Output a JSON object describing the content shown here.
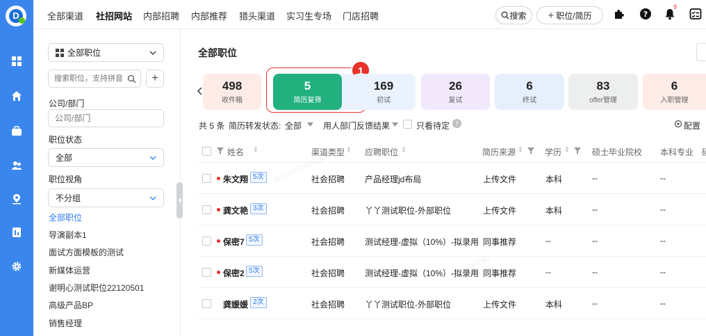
{
  "topnav": {
    "tabs": [
      "全部渠道",
      "社招网站",
      "内部招聘",
      "内部推荐",
      "猎头渠道",
      "实习生专场",
      "门店招聘"
    ],
    "search_label": "搜索",
    "add_label": "职位/简历",
    "notification_count": "9"
  },
  "sidebar": {
    "scope_select": "全部职位",
    "search_placeholder": "搜索职位，支持拼音",
    "company_label": "公司/部门",
    "company_placeholder": "公司/部门",
    "status_label": "职位状态",
    "status_value": "全部",
    "view_label": "职位视角",
    "view_value": "不分组",
    "jobs": [
      "全部职位",
      "导演副本1",
      "面试方面模板的测试",
      "新媒体运营",
      "谢明心测试职位22120501",
      "高级产品BP",
      "销售经理"
    ]
  },
  "main": {
    "title": "全部职位",
    "stages": [
      {
        "num": "498",
        "cap": "收件箱"
      },
      {
        "num": "5",
        "cap": "简历复筛"
      },
      {
        "num": "169",
        "cap": "初试"
      },
      {
        "num": "26",
        "cap": "复试"
      },
      {
        "num": "6",
        "cap": "终试"
      },
      {
        "num": "83",
        "cap": "offer管理"
      },
      {
        "num": "6",
        "cap": "入职管理"
      }
    ],
    "callout_number": "1",
    "filters": {
      "total": "共 5 条",
      "forward_label": "简历转发状态:",
      "forward_value": "全部",
      "feedback_label": "用人部门反馈结果",
      "pending_label": "只看待定",
      "config_label": "配置"
    },
    "columns": [
      "姓名",
      "渠道类型",
      "应聘职位",
      "简历来源",
      "学历",
      "硕士毕业院校",
      "本科专业",
      "硕"
    ],
    "rows": [
      {
        "name": "朱文翔",
        "times": "5次",
        "channel": "社会招聘",
        "job": "产品经理jd布局",
        "source": "上传文件",
        "edu": "本科",
        "school": "--",
        "major": "--",
        "dot": true
      },
      {
        "name": "龚文艳",
        "times": "3次",
        "channel": "社会招聘",
        "job": "丫丫测试职位-外部职位",
        "source": "上传文件",
        "edu": "本科",
        "school": "--",
        "major": "--",
        "dot": true
      },
      {
        "name": "保密7",
        "times": "5次",
        "channel": "社会招聘",
        "job": "测试经理-虚拟（10%）-拟录用",
        "source": "同事推荐",
        "edu": "--",
        "school": "--",
        "major": "--",
        "dot": true
      },
      {
        "name": "保密2",
        "times": "5次",
        "channel": "社会招聘",
        "job": "测试经理-虚拟（10%）-拟录用",
        "source": "同事推荐",
        "edu": "--",
        "school": "--",
        "major": "--",
        "dot": true
      },
      {
        "name": "龚媛媛",
        "times": "2次",
        "channel": "社会招聘",
        "job": "丫丫测试职位-外部职位",
        "source": "上传文件",
        "edu": "本科",
        "school": "--",
        "major": "--",
        "dot": false
      }
    ],
    "watermark": [
      "dayeechangpin",
      "superda"
    ]
  }
}
